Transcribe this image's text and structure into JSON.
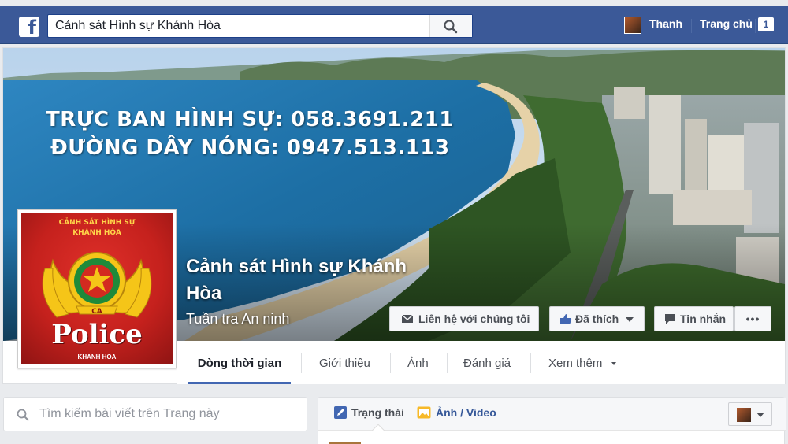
{
  "topbar": {
    "logo": "f",
    "search_value": "Cảnh sát Hình sự Khánh Hòa",
    "search_icon": "search-icon",
    "user_name": "Thanh",
    "home_label": "Trang chủ",
    "home_badge": "1"
  },
  "cover": {
    "line1": "TRỰC BAN HÌNH SỰ: 058.3691.211",
    "line2": "ĐƯỜNG DÂY NÓNG: 0947.513.113"
  },
  "profile": {
    "name": "Cảnh sát Hình sự Khánh Hòa",
    "category": "Tuần tra An ninh",
    "pic_top": "CẢNH SÁT HÌNH SỰ\nKHÁNH HÒA",
    "pic_police": "Police",
    "pic_bottom": "KHANH HOA"
  },
  "actions": {
    "contact": "Liên hệ với chúng tôi",
    "liked": "Đã thích",
    "message": "Tin nhắn",
    "more": "•••"
  },
  "tabs": [
    "Dòng thời gian",
    "Giới thiệu",
    "Ảnh",
    "Đánh giá",
    "Xem thêm"
  ],
  "left_search": {
    "placeholder": "Tìm kiếm bài viết trên Trang này"
  },
  "composer": {
    "status": "Trạng thái",
    "photo": "Ảnh",
    "video": " / Video"
  },
  "colors": {
    "brand": "#3b5998",
    "accent": "#4267b2",
    "picture_red": "#c5211d",
    "emblem_gold": "#f5c518"
  }
}
